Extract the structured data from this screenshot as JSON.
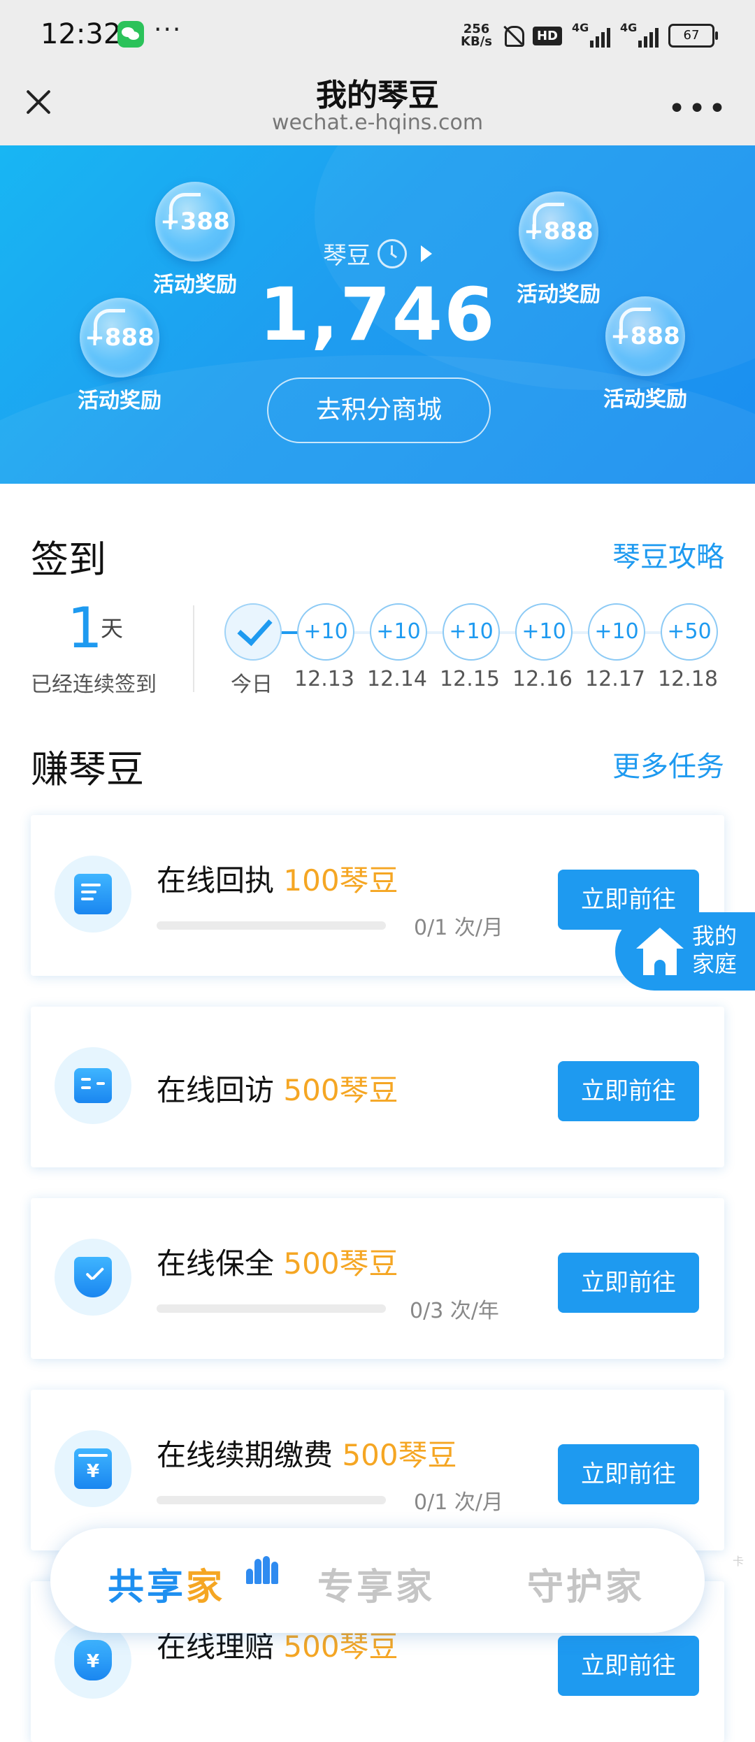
{
  "status_bar": {
    "time": "12:32",
    "more": "···",
    "speed_value": "256",
    "speed_unit": "KB/s",
    "hd_label": "HD",
    "net1": "4G",
    "net2": "4G",
    "battery": "67"
  },
  "title_bar": {
    "title": "我的琴豆",
    "url": "wechat.e-hqins.com",
    "menu": "•••"
  },
  "hero": {
    "label": "琴豆",
    "points": "1,746",
    "mall_button": "去积分商城",
    "bubbles": [
      {
        "value": "+388",
        "label": "活动奖励"
      },
      {
        "value": "+888",
        "label": "活动奖励"
      },
      {
        "value": "+888",
        "label": "活动奖励"
      },
      {
        "value": "+888",
        "label": "活动奖励"
      }
    ]
  },
  "signin": {
    "title": "签到",
    "link": "琴豆攻略",
    "streak_count": "1",
    "streak_unit": "天",
    "streak_label": "已经连续签到",
    "days": [
      {
        "reward": "",
        "date": "今日",
        "checked": true
      },
      {
        "reward": "+10",
        "date": "12.13"
      },
      {
        "reward": "+10",
        "date": "12.14"
      },
      {
        "reward": "+10",
        "date": "12.15"
      },
      {
        "reward": "+10",
        "date": "12.16"
      },
      {
        "reward": "+10",
        "date": "12.17"
      },
      {
        "reward": "+50",
        "date": "12.18"
      }
    ]
  },
  "earn": {
    "title": "赚琴豆",
    "link": "更多任务",
    "tasks": [
      {
        "name": "在线回执",
        "reward": "100琴豆",
        "progress": "0/1 次/月",
        "button": "立即前往",
        "icon": "document-check-icon"
      },
      {
        "name": "在线回访",
        "reward": "500琴豆",
        "progress": "",
        "button": "立即前往",
        "icon": "id-card-icon"
      },
      {
        "name": "在线保全",
        "reward": "500琴豆",
        "progress": "0/3 次/年",
        "button": "立即前往",
        "icon": "shield-check-icon"
      },
      {
        "name": "在线续期缴费",
        "reward": "500琴豆",
        "progress": "0/1 次/月",
        "button": "立即前往",
        "icon": "yuan-box-icon"
      },
      {
        "name": "在线理赔",
        "reward": "500琴豆",
        "progress": "",
        "button": "立即前往",
        "icon": "money-bag-icon"
      }
    ]
  },
  "floating": {
    "line1": "我的",
    "line2": "家庭"
  },
  "tabs": {
    "tab1_part1": "共享",
    "tab1_part2": "家",
    "tab2": "专享家",
    "tab3": "守护家"
  },
  "watermark": "卡",
  "colors": {
    "primary": "#1e9af0",
    "accent": "#f5a623"
  }
}
